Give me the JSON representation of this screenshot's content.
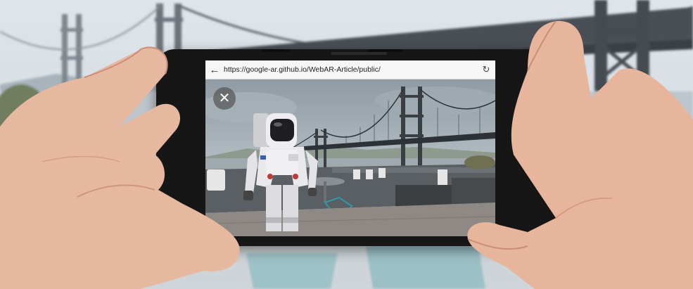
{
  "browser": {
    "url": "https://google-ar.github.io/WebAR-Article/public/",
    "back_icon": "arrow-left-icon",
    "reload_icon": "reload-icon"
  },
  "ar_view": {
    "close_icon": "close-icon",
    "object": "astronaut"
  },
  "colors": {
    "phone_body": "#161616",
    "url_bar": "#f6f6f6",
    "bridge": "#4a4f55",
    "sky": "#c9d2d8",
    "skin": "#e9b9a1"
  }
}
